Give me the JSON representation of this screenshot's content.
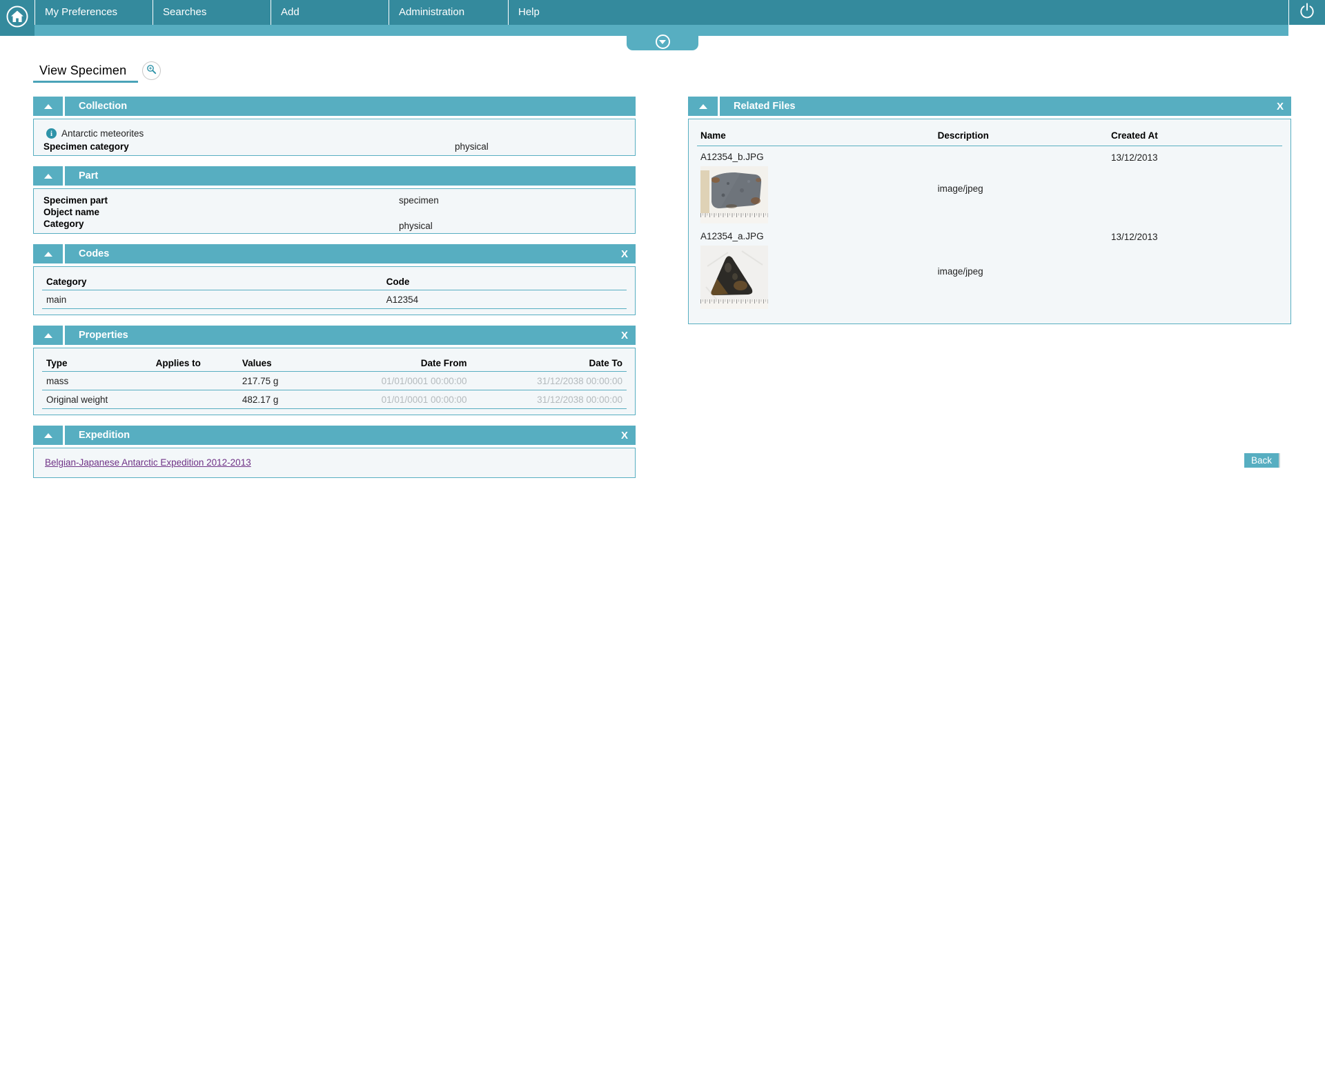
{
  "nav": {
    "items": [
      {
        "label": "My Preferences"
      },
      {
        "label": "Searches"
      },
      {
        "label": "Add"
      },
      {
        "label": "Administration"
      },
      {
        "label": "Help"
      }
    ]
  },
  "page": {
    "title": "View Specimen"
  },
  "panels": {
    "collection": {
      "title": "Collection",
      "info_text": "Antarctic meteorites",
      "row": {
        "label": "Specimen category",
        "value": "physical"
      }
    },
    "part": {
      "title": "Part",
      "rows": [
        {
          "label": "Specimen part",
          "value": "specimen"
        },
        {
          "label": "Object name",
          "value": ""
        },
        {
          "label": "Category",
          "value": "physical"
        }
      ]
    },
    "codes": {
      "title": "Codes",
      "close_label": "X",
      "columns": [
        "Category",
        "Code"
      ],
      "rows": [
        {
          "category": "main",
          "code": "A12354"
        }
      ]
    },
    "properties": {
      "title": "Properties",
      "close_label": "X",
      "columns": [
        "Type",
        "Applies to",
        "Values",
        "Date From",
        "Date To"
      ],
      "rows": [
        {
          "type": "mass",
          "applies_to": "",
          "values": "217.75 g",
          "date_from": "01/01/0001 00:00:00",
          "date_to": "31/12/2038 00:00:00"
        },
        {
          "type": "Original weight",
          "applies_to": "",
          "values": "482.17 g",
          "date_from": "01/01/0001 00:00:00",
          "date_to": "31/12/2038 00:00:00"
        }
      ]
    },
    "expedition": {
      "title": "Expedition",
      "close_label": "X",
      "link_text": "Belgian-Japanese Antarctic Expedition 2012-2013"
    },
    "related_files": {
      "title": "Related Files",
      "close_label": "X",
      "columns": [
        "Name",
        "Description",
        "Created At"
      ],
      "rows": [
        {
          "name": "A12354_b.JPG",
          "description": "image/jpeg",
          "created_at": "13/12/2013"
        },
        {
          "name": "A12354_a.JPG",
          "description": "image/jpeg",
          "created_at": "13/12/2013"
        }
      ]
    }
  },
  "actions": {
    "back_label": "Back"
  },
  "colors": {
    "nav_teal": "#348a9d",
    "accent_teal": "#57aec1",
    "panel_bg": "#f3f7f9",
    "muted_date": "#b4babd",
    "link_purple": "#6f3286"
  }
}
